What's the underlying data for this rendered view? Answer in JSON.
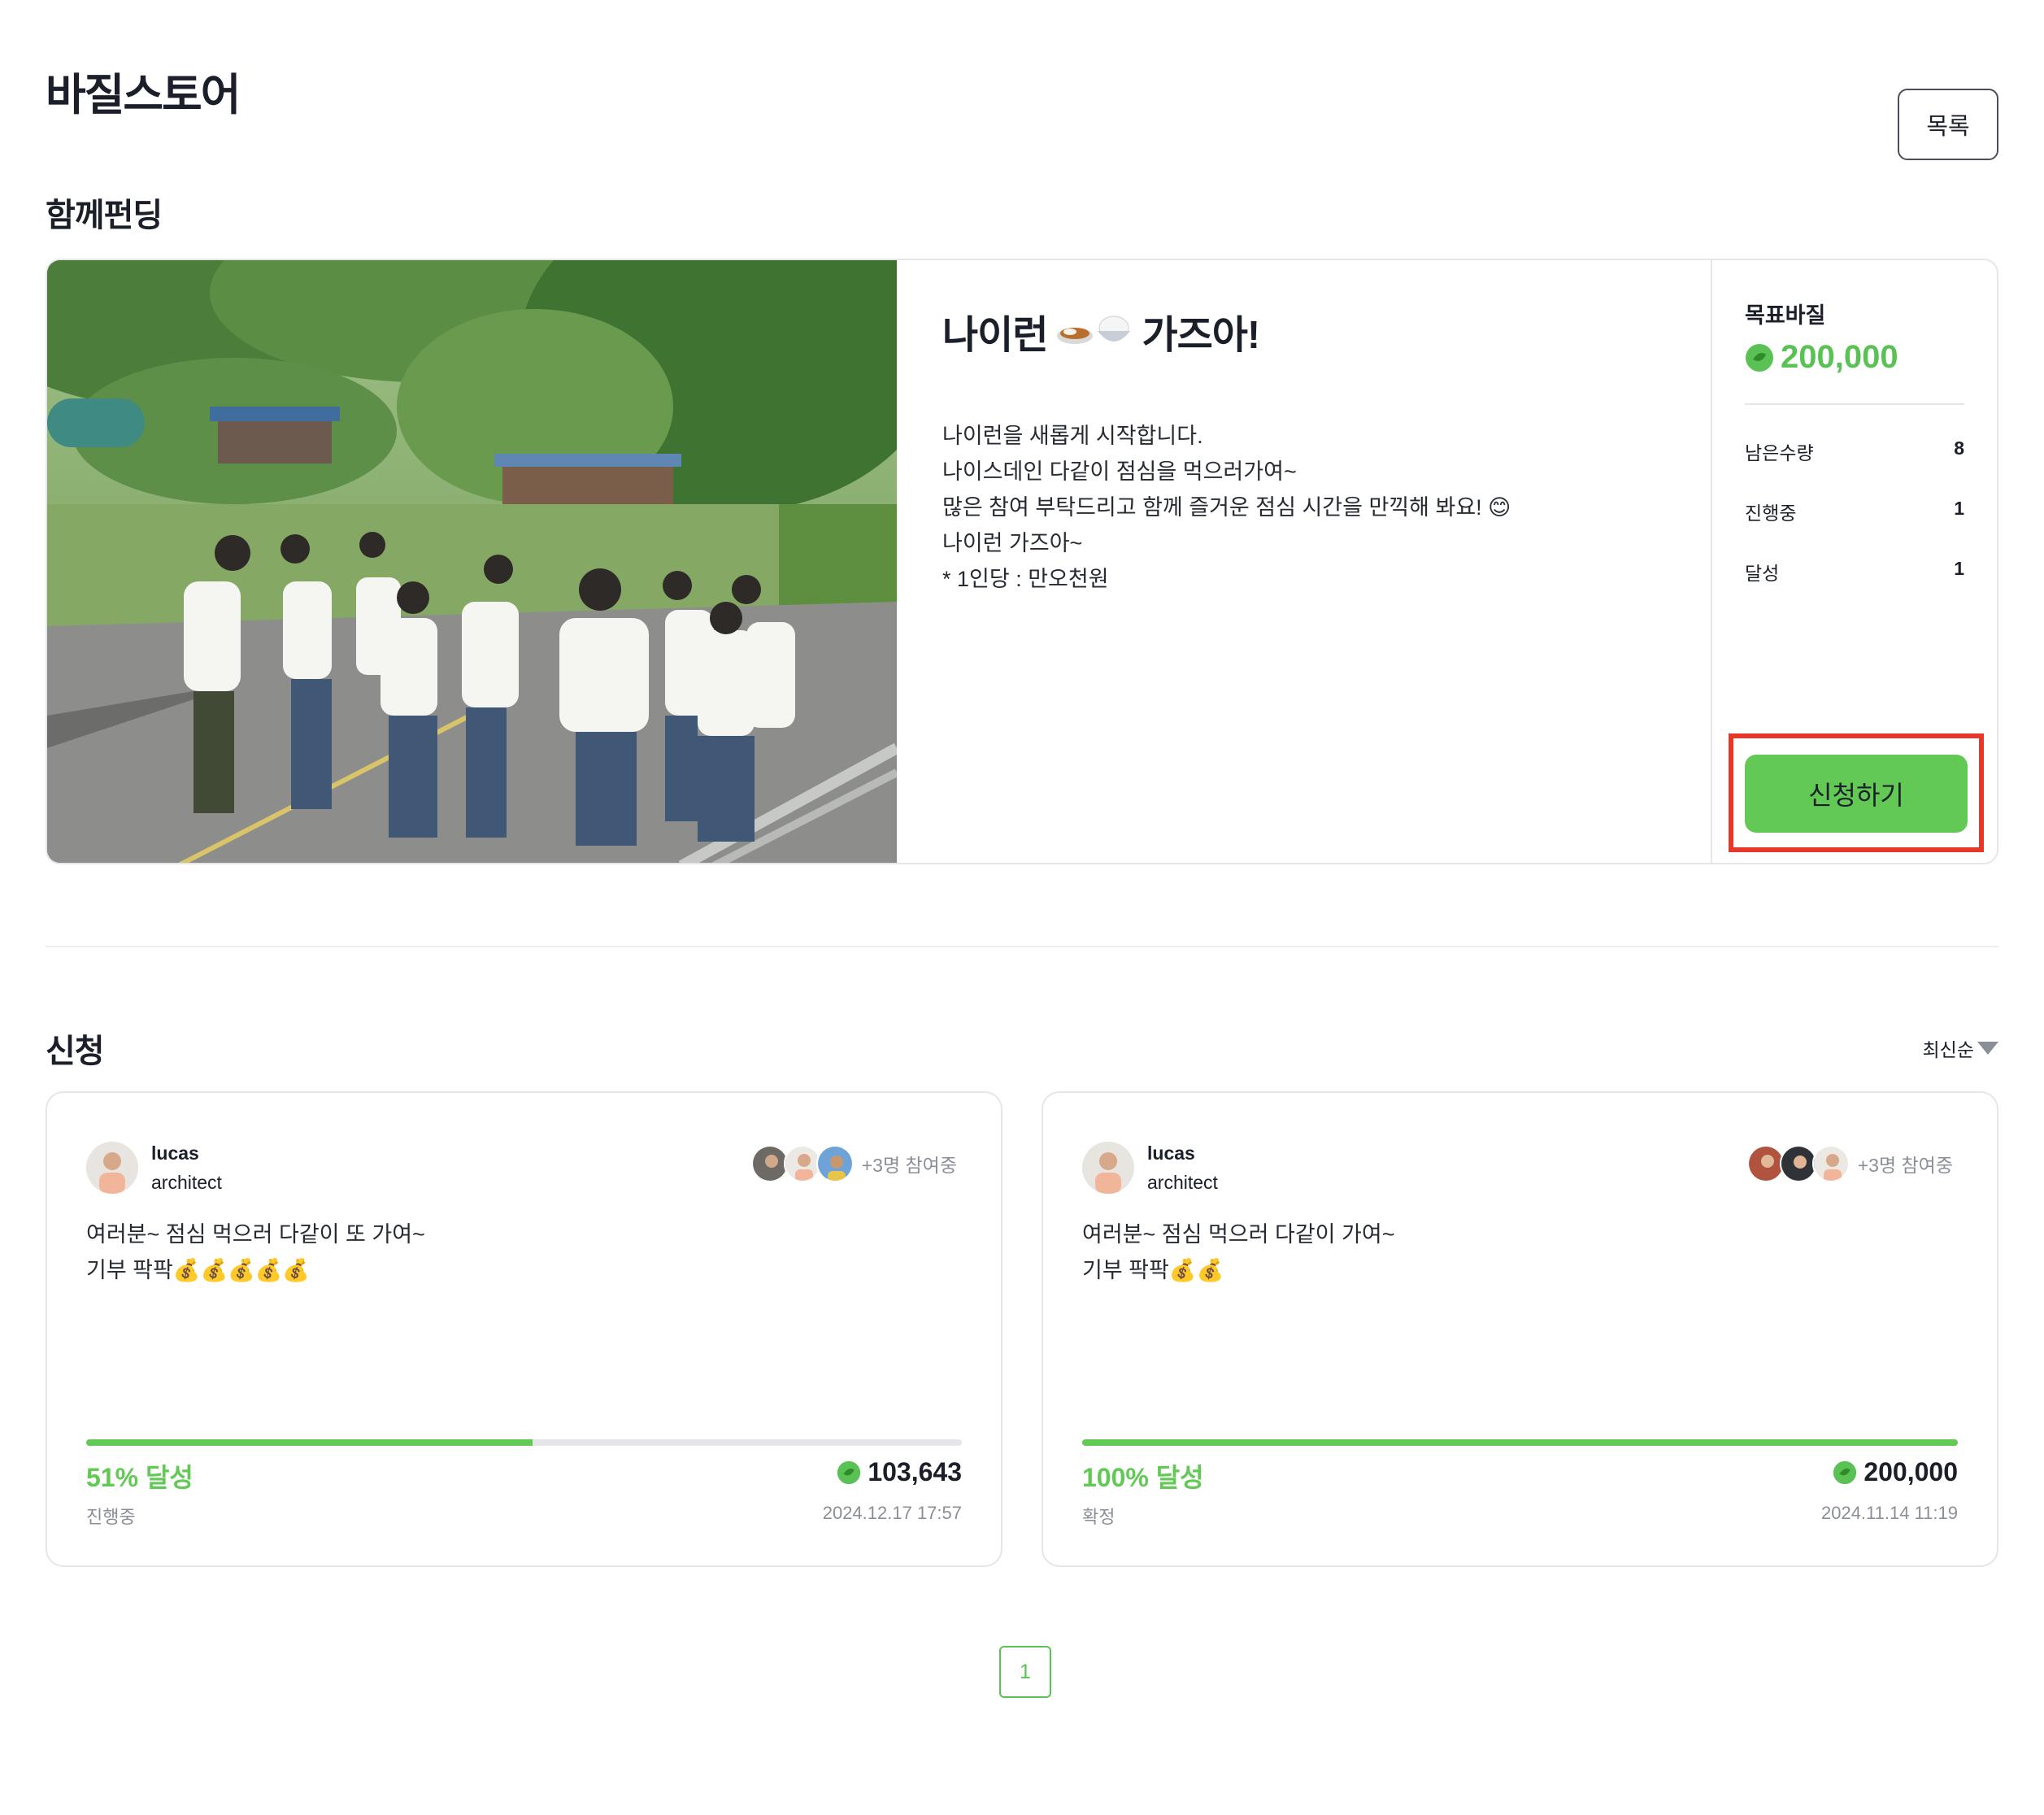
{
  "header": {
    "store_title": "바질스토어",
    "list_button": "목록"
  },
  "funding": {
    "section_title": "함께펀딩",
    "name_prefix": "나이런",
    "name_suffix": "가즈아!",
    "description": [
      "나이런을 새롭게 시작합니다.",
      "나이스데인 다같이 점심을 먹으러가여~",
      "많은 참여 부탁드리고 함께 즐거운 점심 시간을 만끽해 봐요! 😊",
      "나이런 가즈아~",
      "* 1인당 : 만오천원"
    ],
    "goal_label": "목표바질",
    "goal_amount": "200,000",
    "stats": [
      {
        "label": "남은수량",
        "value": "8"
      },
      {
        "label": "진행중",
        "value": "1"
      },
      {
        "label": "달성",
        "value": "1"
      }
    ],
    "apply_button": "신청하기"
  },
  "applications": {
    "section_title": "신청",
    "sort_label": "최신순",
    "cards": [
      {
        "user_name": "lucas",
        "user_role": "architect",
        "participants_text": "+3명 참여중",
        "message": [
          "여러분~ 점심 먹으러 다같이 또 가여~",
          "기부 팍팍💰💰💰💰💰"
        ],
        "progress": 0.51,
        "percent_text": "51% 달성",
        "amount": "103,643",
        "status": "진행중",
        "date": "2024.12.17 17:57"
      },
      {
        "user_name": "lucas",
        "user_role": "architect",
        "participants_text": "+3명 참여중",
        "message": [
          "여러분~ 점심 먹으러 다같이 가여~",
          "기부 팍팍💰💰"
        ],
        "progress": 1.0,
        "percent_text": "100% 달성",
        "amount": "200,000",
        "status": "확정",
        "date": "2024.11.14 11:19"
      }
    ]
  },
  "pagination": {
    "current": "1"
  },
  "colors": {
    "accent": "#62c955",
    "accent_text": "#5ac254",
    "highlight": "#e5372a",
    "border": "#e4e6ea"
  },
  "icons": {
    "currency": "basil-coin-icon",
    "sort": "caret-down-icon",
    "food": [
      "curry-icon",
      "rice-bowl-icon"
    ]
  }
}
